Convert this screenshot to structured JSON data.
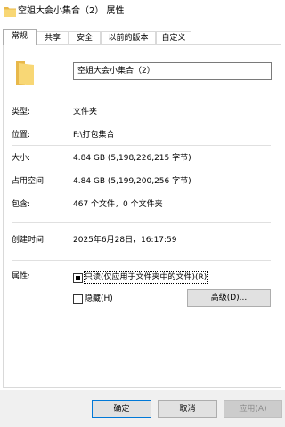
{
  "window": {
    "title": "空姐大会小集合（2） 属性",
    "icon": "folder-icon"
  },
  "tabs": [
    {
      "label": "常规",
      "active": true
    },
    {
      "label": "共享"
    },
    {
      "label": "安全"
    },
    {
      "label": "以前的版本"
    },
    {
      "label": "自定义"
    }
  ],
  "general": {
    "folder_name": "空姐大会小集合（2）",
    "type_label": "类型:",
    "type_value": "文件夹",
    "location_label": "位置:",
    "location_value": "F:\\打包集合",
    "size_label": "大小:",
    "size_value": "4.84 GB (5,198,226,215 字节)",
    "size_on_disk_label": "占用空间:",
    "size_on_disk_value": "4.84 GB (5,199,200,256 字节)",
    "contains_label": "包含:",
    "contains_value": "467 个文件，0 个文件夹",
    "created_label": "创建时间:",
    "created_value": "2025年6月28日，16:17:59",
    "attributes_label": "属性:",
    "readonly_label": "只读(仅应用于文件夹中的文件)(R)",
    "readonly_checked": true,
    "hidden_label": "隐藏(H)",
    "hidden_checked": false,
    "advanced_label": "高级(D)..."
  },
  "buttons": {
    "ok": "确定",
    "cancel": "取消",
    "apply": "应用(A)"
  },
  "colors": {
    "folder": "#f8d775",
    "folder_dark": "#e8b84a",
    "accent": "#0078d7"
  }
}
